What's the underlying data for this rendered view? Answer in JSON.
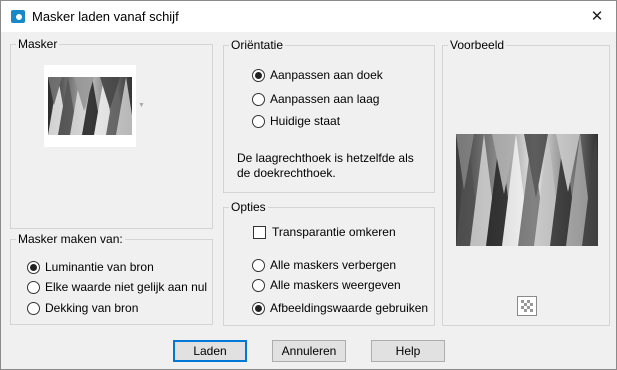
{
  "window": {
    "title": "Masker laden vanaf schijf",
    "close_glyph": "✕"
  },
  "masker_group": {
    "label": "Masker"
  },
  "orientatie": {
    "label": "Oriëntatie",
    "options": [
      {
        "label": "Aanpassen aan doek",
        "selected": true
      },
      {
        "label": "Aanpassen aan laag",
        "selected": false
      },
      {
        "label": "Huidige staat",
        "selected": false
      }
    ],
    "note_line1": "De laagrechthoek is hetzelfde als",
    "note_line2": "de doekrechthoek."
  },
  "voorbeeld": {
    "label": "Voorbeeld"
  },
  "masker_maken": {
    "label": "Masker maken van:",
    "options": [
      {
        "label": "Luminantie van bron",
        "selected": true
      },
      {
        "label": "Elke waarde niet gelijk aan nul",
        "selected": false
      },
      {
        "label": "Dekking van bron",
        "selected": false
      }
    ]
  },
  "opties": {
    "label": "Opties",
    "transparantie": {
      "label": "Transparantie omkeren",
      "checked": false
    },
    "options": [
      {
        "label": "Alle maskers verbergen",
        "selected": false
      },
      {
        "label": "Alle maskers weergeven",
        "selected": false
      },
      {
        "label": "Afbeeldingswaarde gebruiken",
        "selected": true
      }
    ]
  },
  "buttons": {
    "laden": "Laden",
    "annuleren": "Annuleren",
    "help": "Help"
  },
  "colors": {
    "accent": "#0078d7",
    "title_icon": "#1789c9"
  }
}
